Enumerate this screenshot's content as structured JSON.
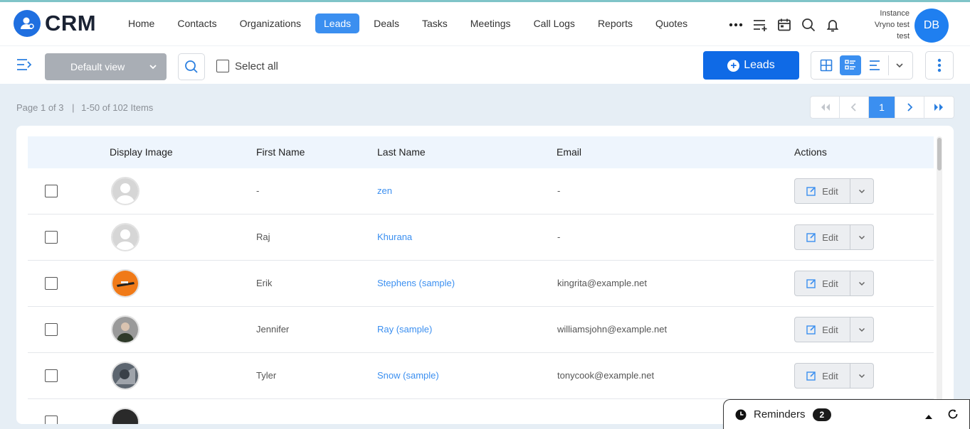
{
  "app": {
    "logo_text": "CRM"
  },
  "nav": {
    "items": [
      "Home",
      "Contacts",
      "Organizations",
      "Leads",
      "Deals",
      "Tasks",
      "Meetings",
      "Call Logs",
      "Reports",
      "Quotes"
    ],
    "active": "Leads",
    "icons": [
      "more-icon",
      "add-list-icon",
      "calendar-icon",
      "search-icon",
      "bell-icon"
    ]
  },
  "user": {
    "line1": "Instance",
    "line2": "Vryno test",
    "line3": "test",
    "initials": "DB"
  },
  "toolbar": {
    "view": "Default view",
    "select_all": "Select all",
    "add_button": "Leads"
  },
  "pagination": {
    "page_text": "Page 1 of 3",
    "items_text": "1-50 of 102 Items",
    "current_page": "1"
  },
  "table": {
    "headers": {
      "display_image": "Display Image",
      "first_name": "First Name",
      "last_name": "Last Name",
      "email": "Email",
      "actions": "Actions"
    },
    "edit_label": "Edit",
    "rows": [
      {
        "first": "-",
        "last": "zen",
        "email": "-",
        "avatar": "placeholder"
      },
      {
        "first": "Raj",
        "last": "Khurana",
        "email": "-",
        "avatar": "placeholder"
      },
      {
        "first": "Erik",
        "last": "Stephens (sample)",
        "email": "kingrita@example.net",
        "avatar": "orange-photo"
      },
      {
        "first": "Jennifer",
        "last": "Ray (sample)",
        "email": "williamsjohn@example.net",
        "avatar": "person-photo"
      },
      {
        "first": "Tyler",
        "last": "Snow (sample)",
        "email": "tonycook@example.net",
        "avatar": "gray-photo"
      }
    ]
  },
  "reminders": {
    "label": "Reminders",
    "count": "2"
  },
  "colors": {
    "primary": "#0f6ae6",
    "accent": "#3b8ff0",
    "link": "#3b8ff0"
  }
}
